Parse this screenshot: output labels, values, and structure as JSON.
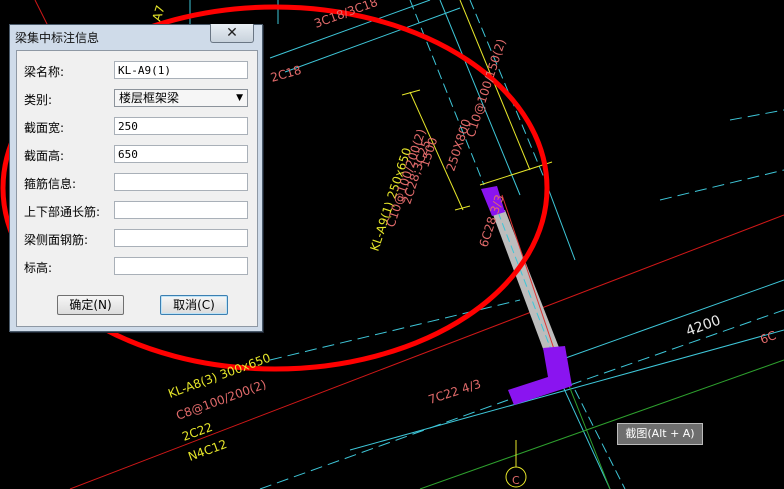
{
  "dialog": {
    "title": "梁集中标注信息",
    "close_symbol": "✕",
    "fields": [
      {
        "label": "梁名称:",
        "value": "KL-A9(1)"
      },
      {
        "label": "类别:",
        "value": "楼层框架梁"
      },
      {
        "label": "截面宽:",
        "value": "250"
      },
      {
        "label": "截面高:",
        "value": "650"
      },
      {
        "label": "箍筋信息:",
        "value": ""
      },
      {
        "label": "上下部通长筋:",
        "value": ""
      },
      {
        "label": "梁侧面钢筋:",
        "value": ""
      },
      {
        "label": "标高:",
        "value": ""
      }
    ],
    "ok_label": "确定(N)",
    "cancel_label": "取消(C)"
  },
  "tooltip": "截图(Alt + A)",
  "drawing": {
    "beam_a9": {
      "name": "KL-A9(1) 250x650",
      "stirrup": "C10@100/200(2)",
      "bars": "2C28;3C25"
    },
    "dim_1500": "1500",
    "section_250x800": "250X800",
    "stirrup_right": "C10@100/150(2)",
    "bottom_bar": "6C28 3/3",
    "top_label": "3C18/3C18",
    "left_2c18": "2C18",
    "beam_a8": {
      "name": "KL-A8(3) 300x650",
      "stirrup": "C8@100/200(2)",
      "bars": "2C22",
      "side": "N4C12"
    },
    "bar_7c22": "7C22 4/3",
    "dim_4200": "4200",
    "edge_a7": "A7",
    "edge_6c": "6C",
    "edge_c": "C"
  },
  "colors": {
    "background": "#000000",
    "annotation_red": "#e06a6a",
    "annotation_yellow": "#e6e62a",
    "cyan_lines": "#3ec6d8",
    "purple_column": "#8a14f0",
    "red_circle": "#ff0000"
  }
}
